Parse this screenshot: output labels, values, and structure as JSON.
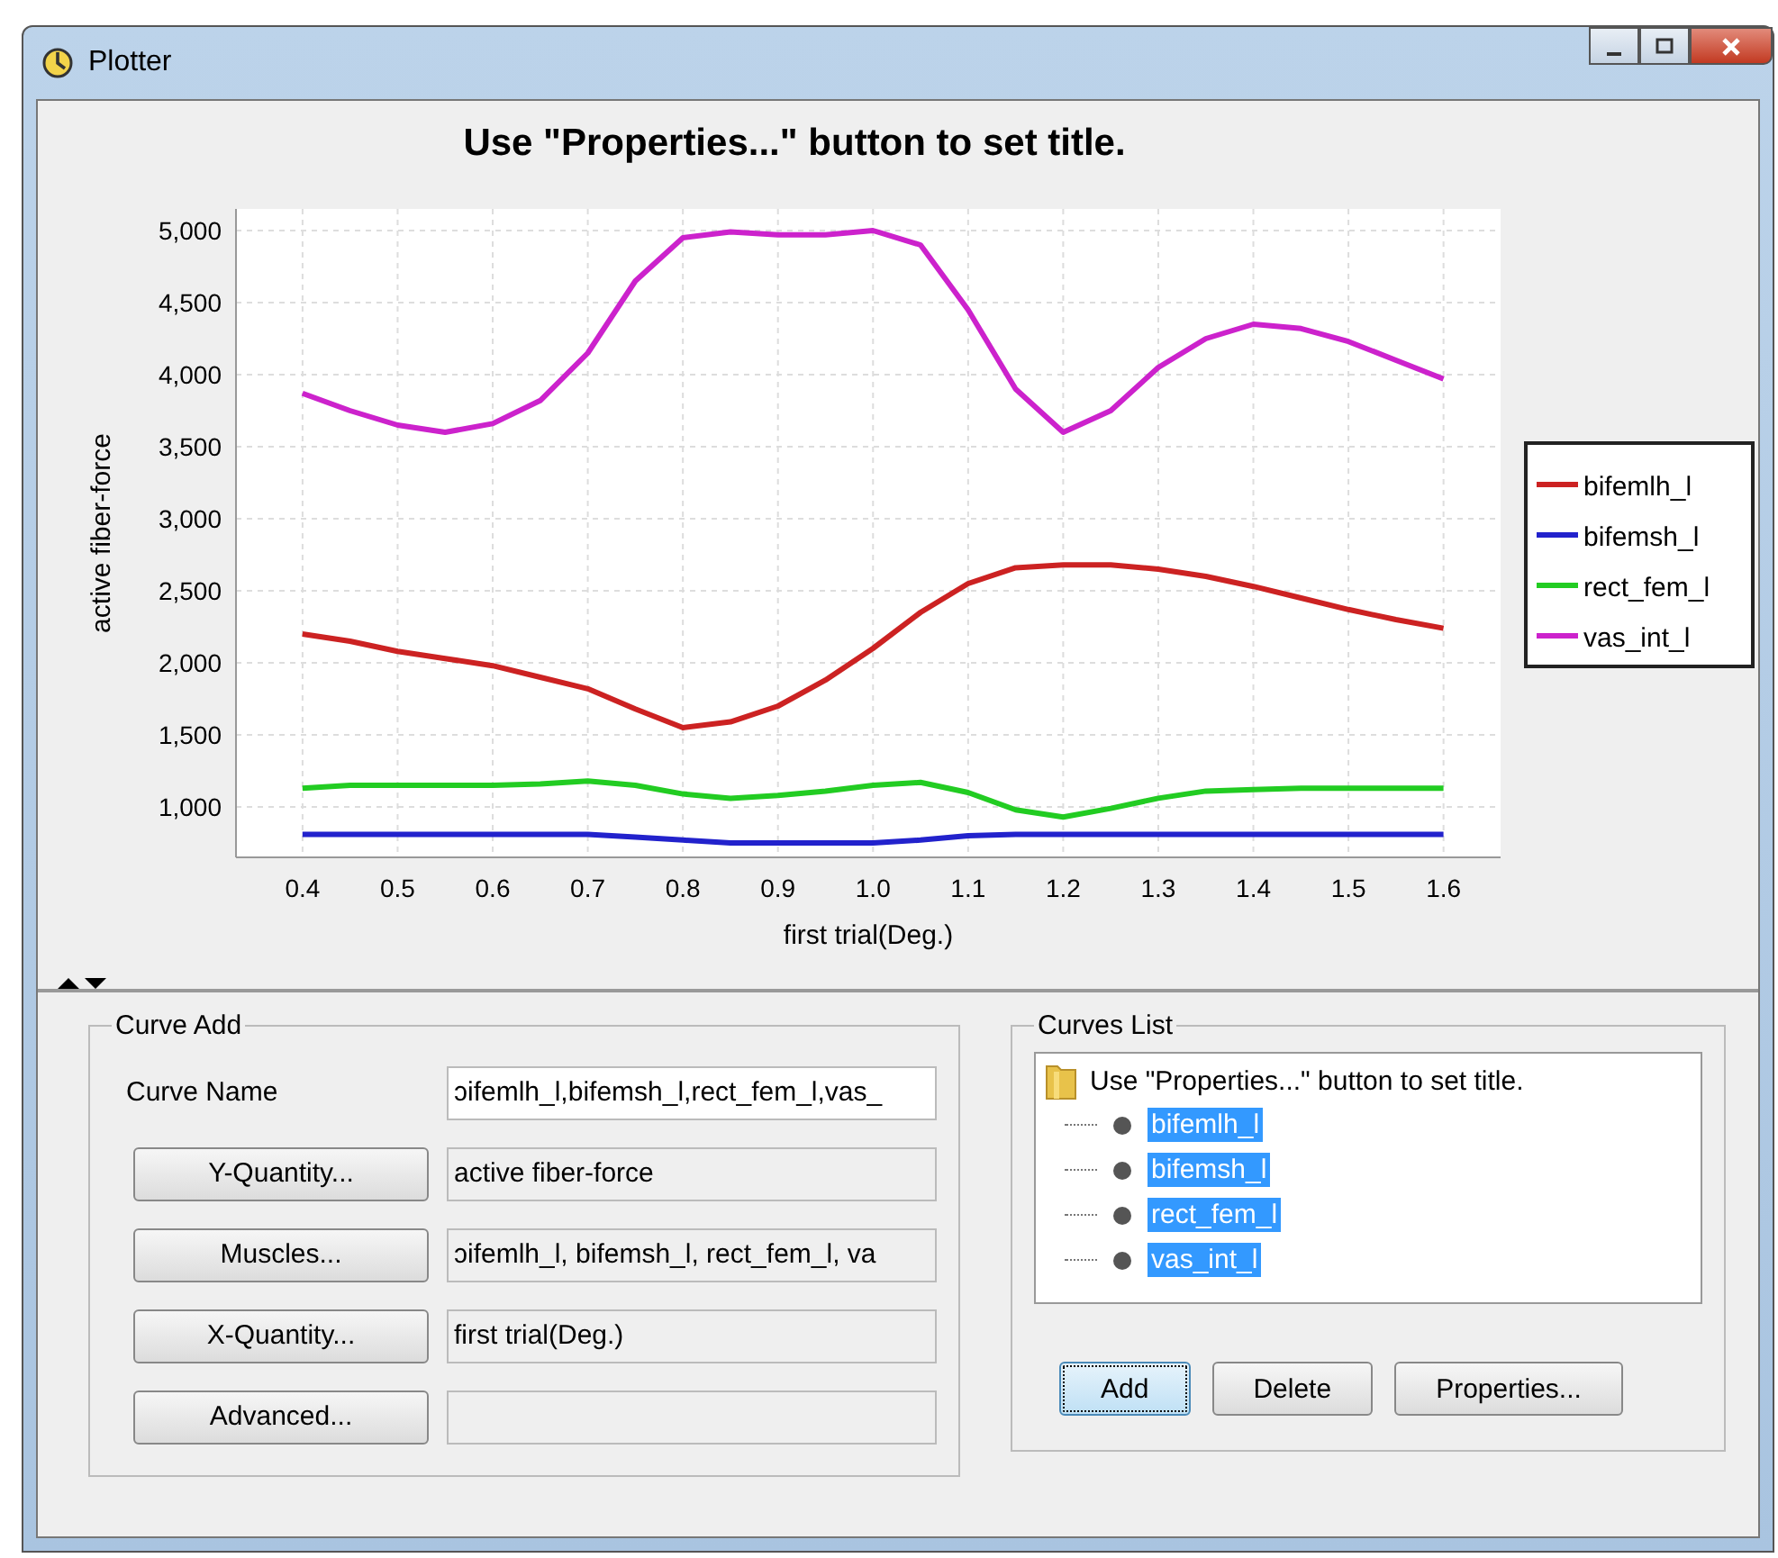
{
  "window": {
    "title": "Plotter"
  },
  "chart": {
    "chart_data": {
      "type": "line",
      "title": "Use \"Properties...\" button to set title.",
      "xlabel": "first trial(Deg.)",
      "ylabel": "active fiber-force",
      "x": [
        0.4,
        0.45,
        0.5,
        0.55,
        0.6,
        0.65,
        0.7,
        0.75,
        0.8,
        0.85,
        0.9,
        0.95,
        1.0,
        1.05,
        1.1,
        1.15,
        1.2,
        1.25,
        1.3,
        1.35,
        1.4,
        1.45,
        1.5,
        1.55,
        1.6
      ],
      "series": [
        {
          "name": "bifemlh_l",
          "color": "#cc2222",
          "values": [
            2200,
            2150,
            2080,
            2030,
            1980,
            1900,
            1820,
            1680,
            1550,
            1590,
            1700,
            1880,
            2100,
            2350,
            2550,
            2660,
            2680,
            2680,
            2650,
            2600,
            2530,
            2450,
            2370,
            2300,
            2240
          ]
        },
        {
          "name": "bifemsh_l",
          "color": "#2222cc",
          "values": [
            810,
            810,
            810,
            810,
            810,
            810,
            810,
            790,
            770,
            750,
            750,
            750,
            750,
            770,
            800,
            810,
            810,
            810,
            810,
            810,
            810,
            810,
            810,
            810,
            810
          ]
        },
        {
          "name": "rect_fem_l",
          "color": "#22cc22",
          "values": [
            1130,
            1150,
            1150,
            1150,
            1150,
            1160,
            1180,
            1150,
            1090,
            1060,
            1080,
            1110,
            1150,
            1170,
            1100,
            980,
            930,
            990,
            1060,
            1110,
            1120,
            1130,
            1130,
            1130,
            1130
          ]
        },
        {
          "name": "vas_int_l",
          "color": "#cc22cc",
          "values": [
            3870,
            3750,
            3650,
            3600,
            3660,
            3820,
            4150,
            4650,
            4950,
            4990,
            4970,
            4970,
            5000,
            4900,
            4450,
            3900,
            3600,
            3750,
            4050,
            4250,
            4350,
            4320,
            4230,
            4100,
            3970
          ]
        }
      ],
      "grid": true,
      "legend": true,
      "xlim": [
        0.33,
        1.66
      ],
      "ylim": [
        650,
        5150
      ],
      "xticks": [
        {
          "value": 0.4,
          "label": "0.4"
        },
        {
          "value": 0.5,
          "label": "0.5"
        },
        {
          "value": 0.6,
          "label": "0.6"
        },
        {
          "value": 0.7,
          "label": "0.7"
        },
        {
          "value": 0.8,
          "label": "0.8"
        },
        {
          "value": 0.9,
          "label": "0.9"
        },
        {
          "value": 1.0,
          "label": "1.0"
        },
        {
          "value": 1.1,
          "label": "1.1"
        },
        {
          "value": 1.2,
          "label": "1.2"
        },
        {
          "value": 1.3,
          "label": "1.3"
        },
        {
          "value": 1.4,
          "label": "1.4"
        },
        {
          "value": 1.5,
          "label": "1.5"
        },
        {
          "value": 1.6,
          "label": "1.6"
        }
      ],
      "yticks": [
        {
          "value": 1000,
          "label": "1,000"
        },
        {
          "value": 1500,
          "label": "1,500"
        },
        {
          "value": 2000,
          "label": "2,000"
        },
        {
          "value": 2500,
          "label": "2,500"
        },
        {
          "value": 3000,
          "label": "3,000"
        },
        {
          "value": 3500,
          "label": "3,500"
        },
        {
          "value": 4000,
          "label": "4,000"
        },
        {
          "value": 4500,
          "label": "4,500"
        },
        {
          "value": 5000,
          "label": "5,000"
        }
      ]
    }
  },
  "curve_add": {
    "title": "Curve Add",
    "name_label": "Curve Name",
    "name_value": "ɔifemlh_l,bifemsh_l,rect_fem_l,vas_",
    "rows": [
      {
        "button": "Y-Quantity...",
        "value": "active fiber-force"
      },
      {
        "button": "Muscles...",
        "value": "ɔifemlh_l, bifemsh_l, rect_fem_l, va"
      },
      {
        "button": "X-Quantity...",
        "value": "first trial(Deg.)"
      },
      {
        "button": "Advanced..."
      }
    ]
  },
  "curves_list": {
    "title": "Curves List",
    "root": "Use \"Properties...\" button to set title.",
    "children": [
      {
        "label": "bifemlh_l",
        "selected": true
      },
      {
        "label": "bifemsh_l",
        "selected": true
      },
      {
        "label": "rect_fem_l",
        "selected": true
      },
      {
        "label": "vas_int_l",
        "selected": true
      }
    ],
    "buttons": [
      {
        "label": "Add",
        "focused": true
      },
      {
        "label": "Delete",
        "focused": false
      },
      {
        "label": "Properties...",
        "focused": false
      }
    ]
  }
}
